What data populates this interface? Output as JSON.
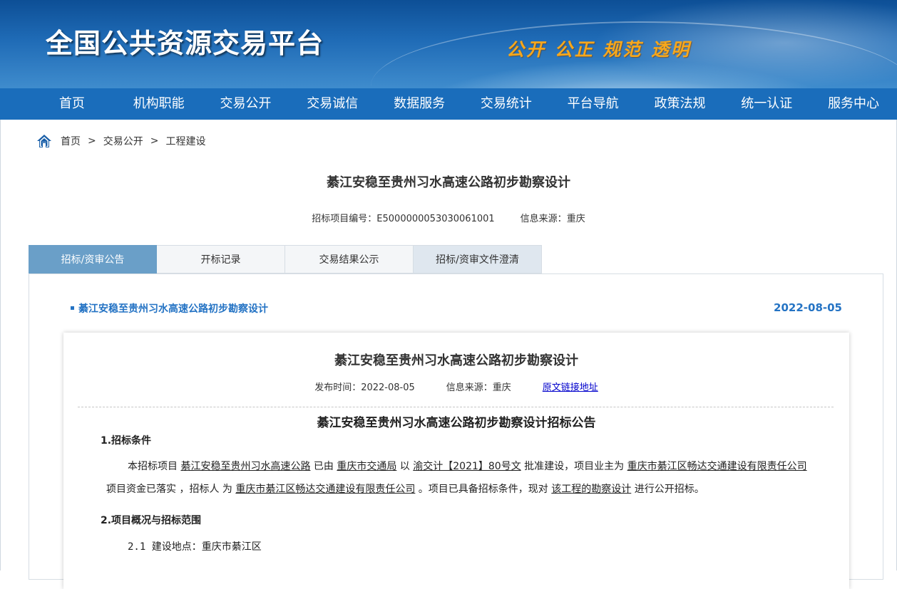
{
  "banner": {
    "site_title": "全国公共资源交易平台",
    "slogan": "公开 公正 规范 透明"
  },
  "nav": {
    "items": [
      "首页",
      "机构职能",
      "交易公开",
      "交易诚信",
      "数据服务",
      "交易统计",
      "平台导航",
      "政策法规",
      "统一认证",
      "服务中心"
    ]
  },
  "breadcrumb": {
    "items": [
      "首页",
      "交易公开",
      "工程建设"
    ],
    "separator": ">"
  },
  "project": {
    "title": "綦江安稳至贵州习水高速公路初步勘察设计",
    "code_label": "招标项目编号：",
    "code": "E5000000053030061001",
    "source_label": "信息来源：",
    "source": "重庆"
  },
  "tabs": [
    "招标/资审公告",
    "开标记录",
    "交易结果公示",
    "招标/资审文件澄清"
  ],
  "notice": {
    "title": "綦江安稳至贵州习水高速公路初步勘察设计",
    "date": "2022-08-05"
  },
  "card": {
    "title": "綦江安稳至贵州习水高速公路初步勘察设计",
    "publish_label": "发布时间：",
    "publish_date": "2022-08-05",
    "source_label": "信息来源：",
    "source": "重庆",
    "link_text": "原文链接地址",
    "doc_title": "綦江安稳至贵州习水高速公路初步勘察设计招标公告",
    "section1_heading": "1.招标条件",
    "p1": {
      "t1": "本招标项目 ",
      "u1": "綦江安稳至贵州习水高速公路",
      "t2": " 已由 ",
      "u2": "重庆市交通局",
      "t3": " 以 ",
      "u3": "渝交计【2021】80号文",
      "t4": " 批准建设，项目业主为 ",
      "u4": "重庆市綦江区畅达交通建设有限责任公司",
      "t5": " ，"
    },
    "p2": {
      "t1": "项目资金已落实 ，招标人 为 ",
      "u1": "重庆市綦江区畅达交通建设有限责任公司",
      "t2": " 。项目已具备招标条件，现对 ",
      "u2": "该工程的勘察设计",
      "t3": " 进行公开招标。"
    },
    "section2_heading": "2.项目概况与招标范围",
    "location": "2.1 建设地点：重庆市綦江区"
  },
  "colors": {
    "nav_bg": "#1a6dbb",
    "tab_active": "#6a9fc8",
    "link_blue": "#2473c4",
    "slogan": "#f6a71c"
  }
}
